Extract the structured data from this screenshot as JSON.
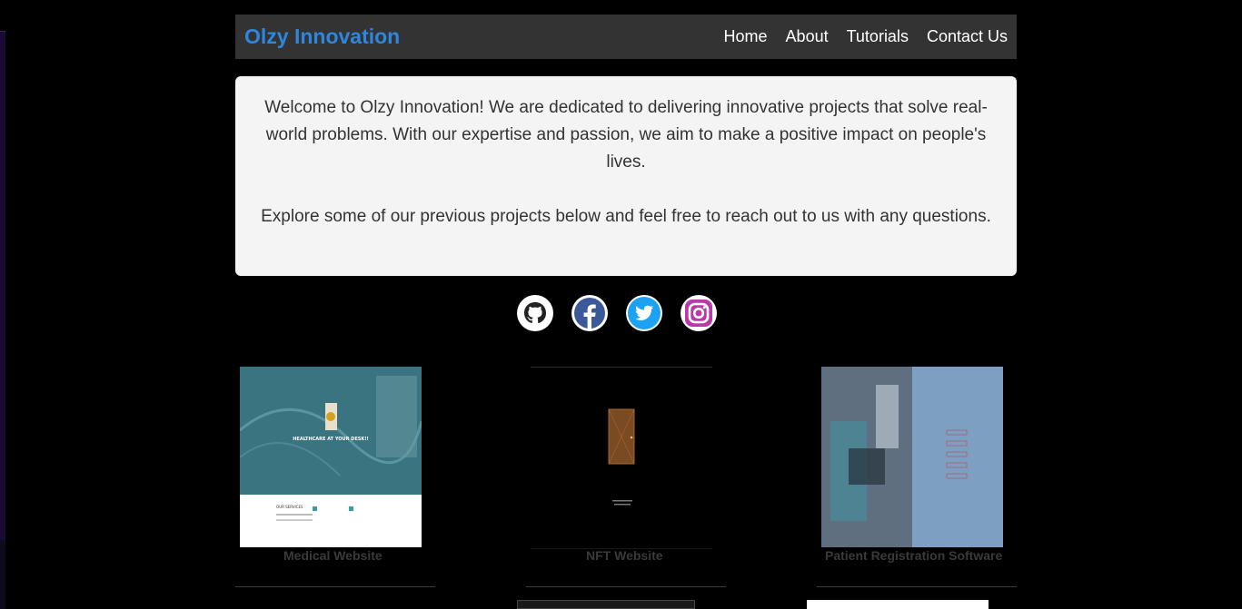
{
  "brand": {
    "name": "Olzy Innovation"
  },
  "nav": {
    "items": [
      "Home",
      "About",
      "Tutorials",
      "Contact Us"
    ]
  },
  "intro": {
    "paragraph1": "Welcome to Olzy Innovation! We are dedicated to delivering innovative projects that solve real-world problems. With our expertise and passion, we aim to make a positive impact on people's lives.",
    "paragraph2": "Explore some of our previous projects below and feel free to reach out to us with any questions."
  },
  "socials": [
    "github-icon",
    "facebook-icon",
    "twitter-icon",
    "instagram-icon"
  ],
  "projects": [
    {
      "title": "Medical Website",
      "thumb_text": "HEALTHCARE AT YOUR DESK!!",
      "thumb_sub": "OUR SERVICES"
    },
    {
      "title": "NFT Website"
    },
    {
      "title": "Patient Registration Software"
    }
  ],
  "colors": {
    "brand": "#2e86de",
    "nav_bg": "#333333",
    "page_bg": "#000000",
    "card_bg": "#f4f4f4"
  }
}
